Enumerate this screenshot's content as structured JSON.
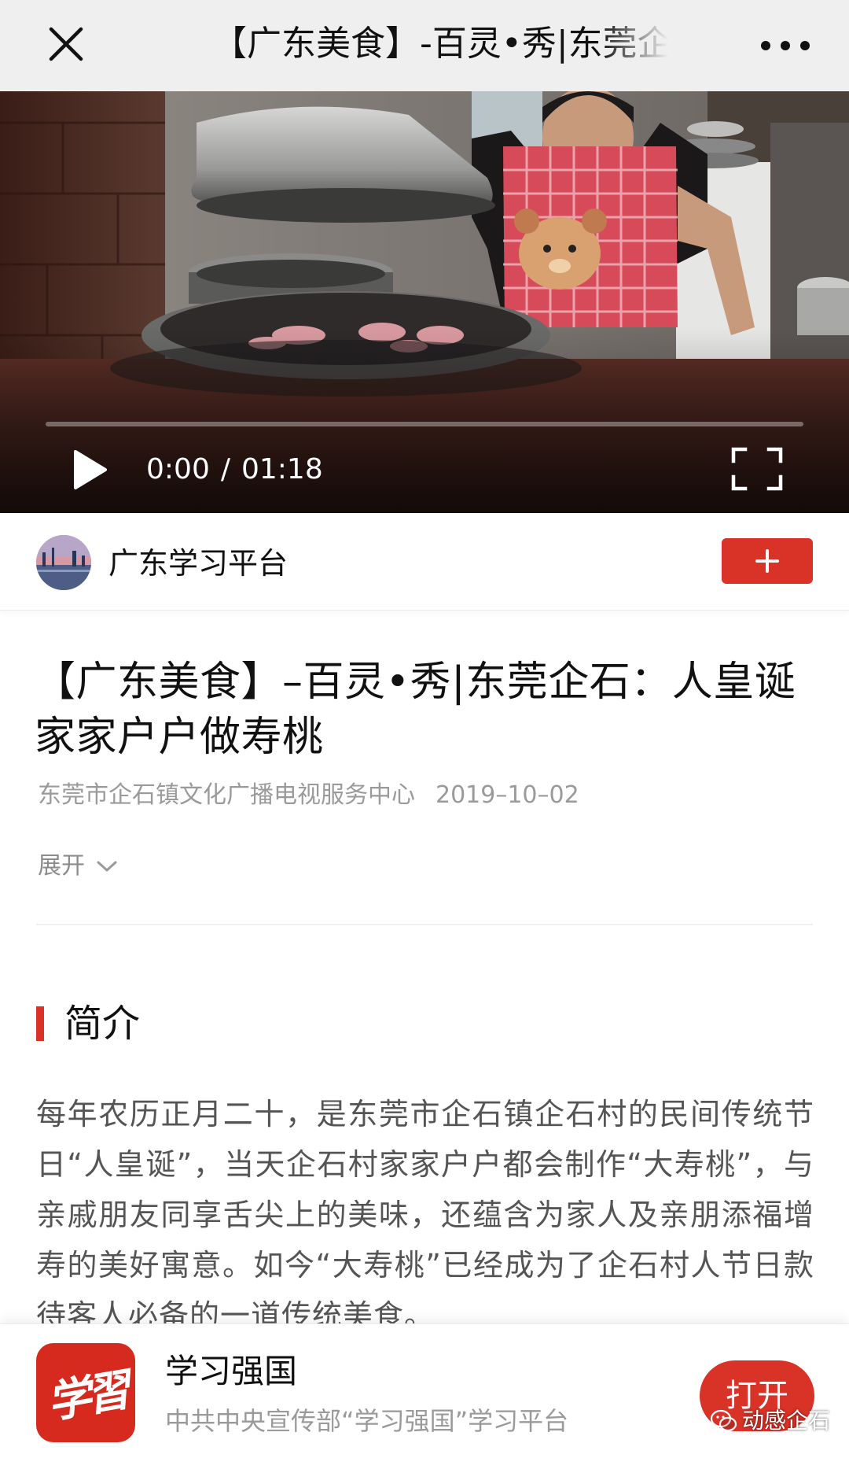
{
  "header": {
    "title": "【广东美食】-百灵•秀|东莞企石：人皇诞 家家户户做寿桃",
    "close_icon": "close-icon",
    "more_icon": "more-dots-icon"
  },
  "video": {
    "current_time": "0:00",
    "separator": "/",
    "duration": "01:18",
    "progress": 0,
    "play_icon": "play-icon",
    "fullscreen_icon": "fullscreen-icon"
  },
  "channel": {
    "name": "广东学习平台",
    "follow_icon": "plus-icon"
  },
  "article": {
    "title": "【广东美食】–百灵•秀|东莞企石：人皇诞 家家户户做寿桃",
    "source": "东莞市企石镇文化广播电视服务中心",
    "date": "2019–10–02",
    "expand_label": "展开"
  },
  "intro": {
    "heading": "简介",
    "body": "每年农历正月二十，是东莞市企石镇企石村的民间传统节日“人皇诞”，当天企石村家家户户都会制作“大寿桃”，与亲戚朋友同享舌尖上的美味，还蕴含为家人及亲朋添福增寿的美好寓意。如今“大寿桃”已经成为了企石村人节日款待客人必备的一道传统美食。"
  },
  "app_banner": {
    "logo_text": "学習",
    "name": "学习强国",
    "description": "中共中央宣传部“学习强国”学习平台",
    "open_label": "打开"
  },
  "watermark": {
    "text": "动感企石",
    "icon": "wechat-icon"
  },
  "colors": {
    "accent": "#d93327",
    "topbar": "#efefef",
    "muted_text": "#9a9a9a"
  }
}
